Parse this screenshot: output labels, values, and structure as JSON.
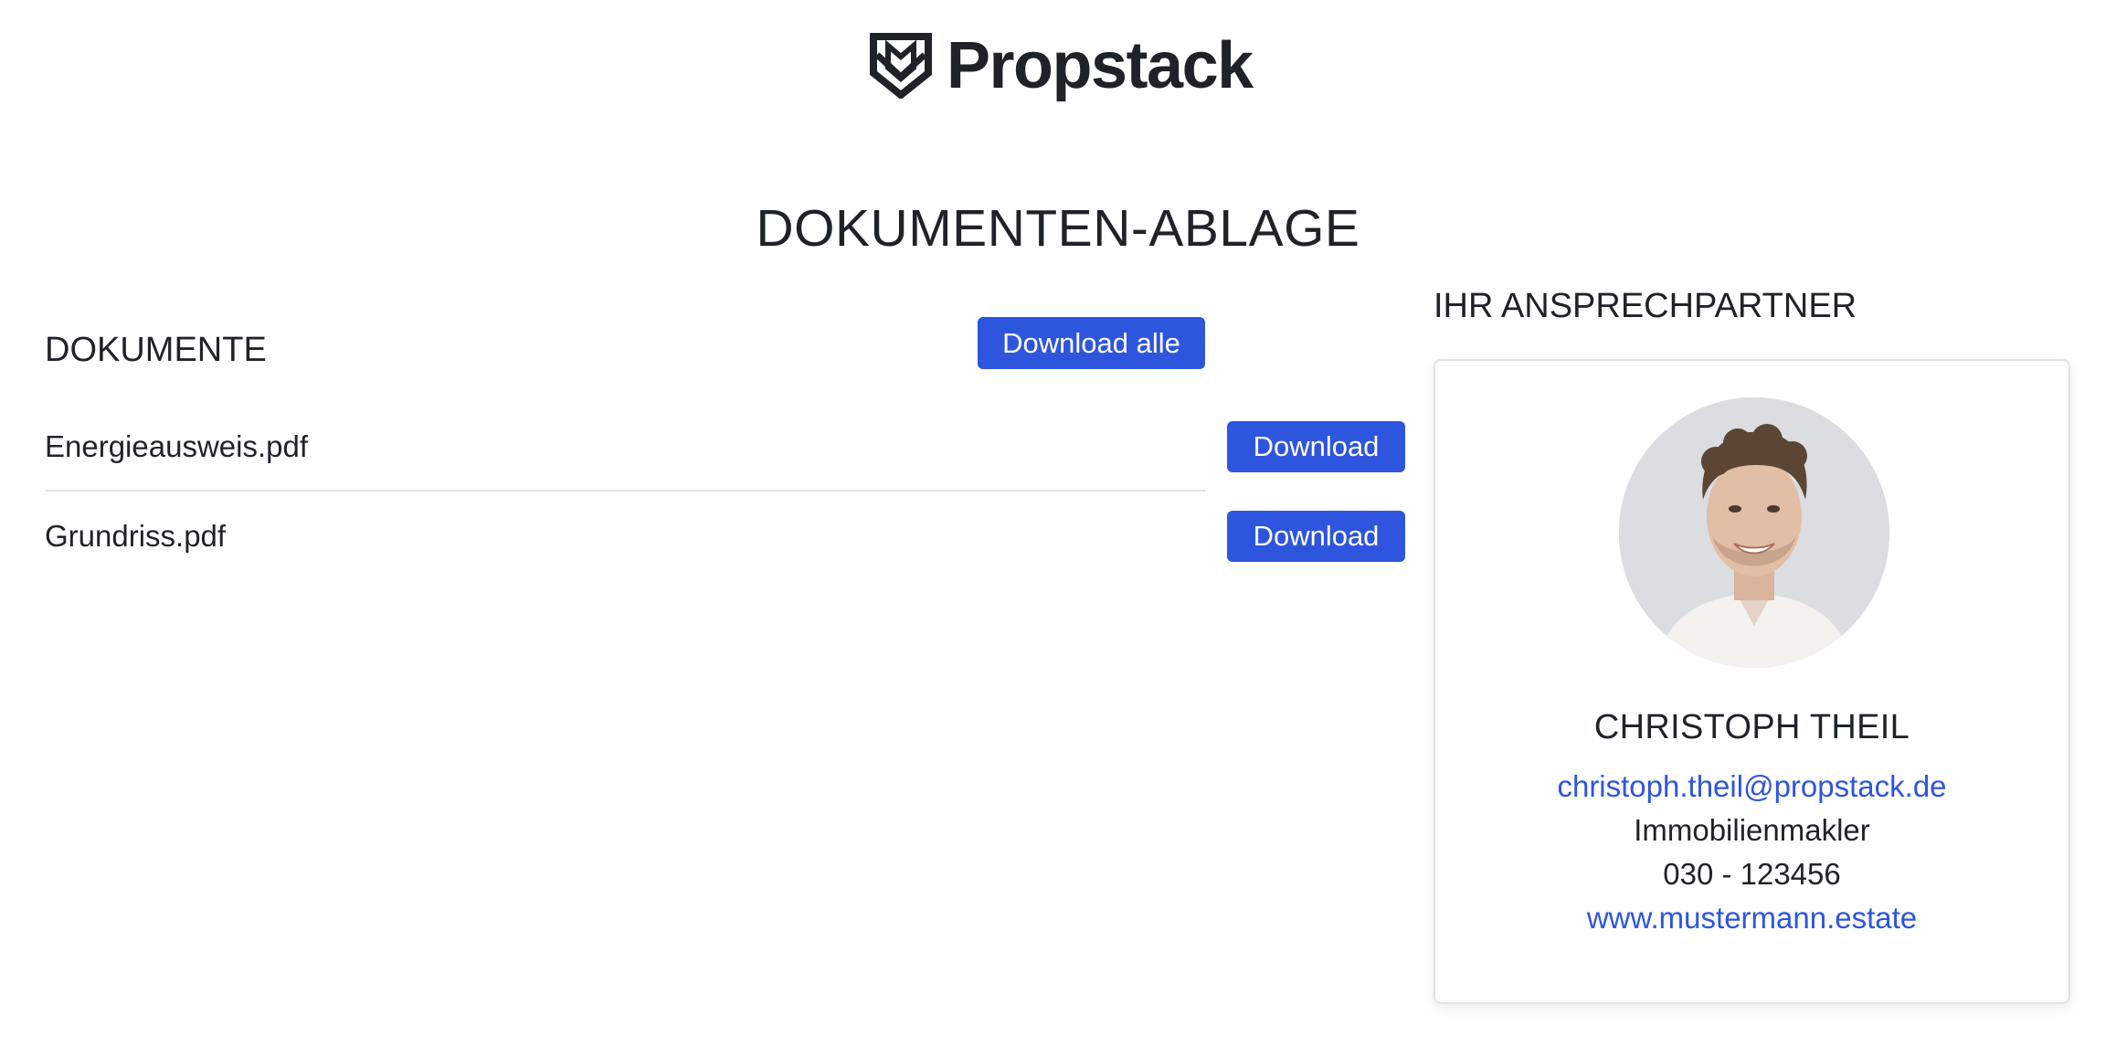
{
  "brand": {
    "name": "Propstack",
    "logo_icon": "propstack-shield-icon"
  },
  "page": {
    "title": "DOKUMENTEN-ABLAGE"
  },
  "documents": {
    "heading": "DOKUMENTE",
    "download_all_label": "Download alle",
    "items": [
      {
        "name": "Energieausweis.pdf",
        "download_label": "Download"
      },
      {
        "name": "Grundriss.pdf",
        "download_label": "Download"
      }
    ]
  },
  "contact": {
    "heading": "IHR ANSPRECHPARTNER",
    "avatar": "contact-photo",
    "name": "CHRISTOPH THEIL",
    "email": "christoph.theil@propstack.de",
    "role": "Immobilienmakler",
    "phone": "030 - 123456",
    "website": "www.mustermann.estate"
  },
  "colors": {
    "accent": "#2e55dd",
    "text": "#1f2328",
    "divider": "#dee2e6",
    "card_border": "#dfe2e6"
  }
}
